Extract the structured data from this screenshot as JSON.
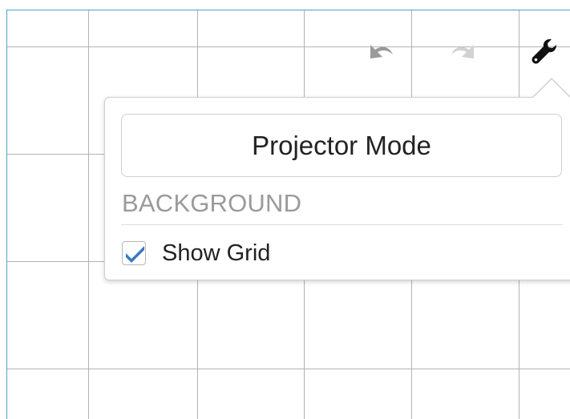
{
  "toolbar": {
    "undo_icon": "undo-icon",
    "redo_icon": "redo-icon",
    "settings_icon": "wrench-icon"
  },
  "settings_popover": {
    "projector_mode_label": "Projector Mode",
    "background_section_title": "BACKGROUND",
    "show_grid_label": "Show Grid",
    "show_grid_checked": true
  },
  "colors": {
    "grid_line": "#b3b3b3",
    "frame_border": "#4aa3c8",
    "checkbox_check": "#3a78c2",
    "section_title": "#9a9a9a",
    "icon_active": "#111111",
    "icon_disabled": "#9a9a9a"
  }
}
